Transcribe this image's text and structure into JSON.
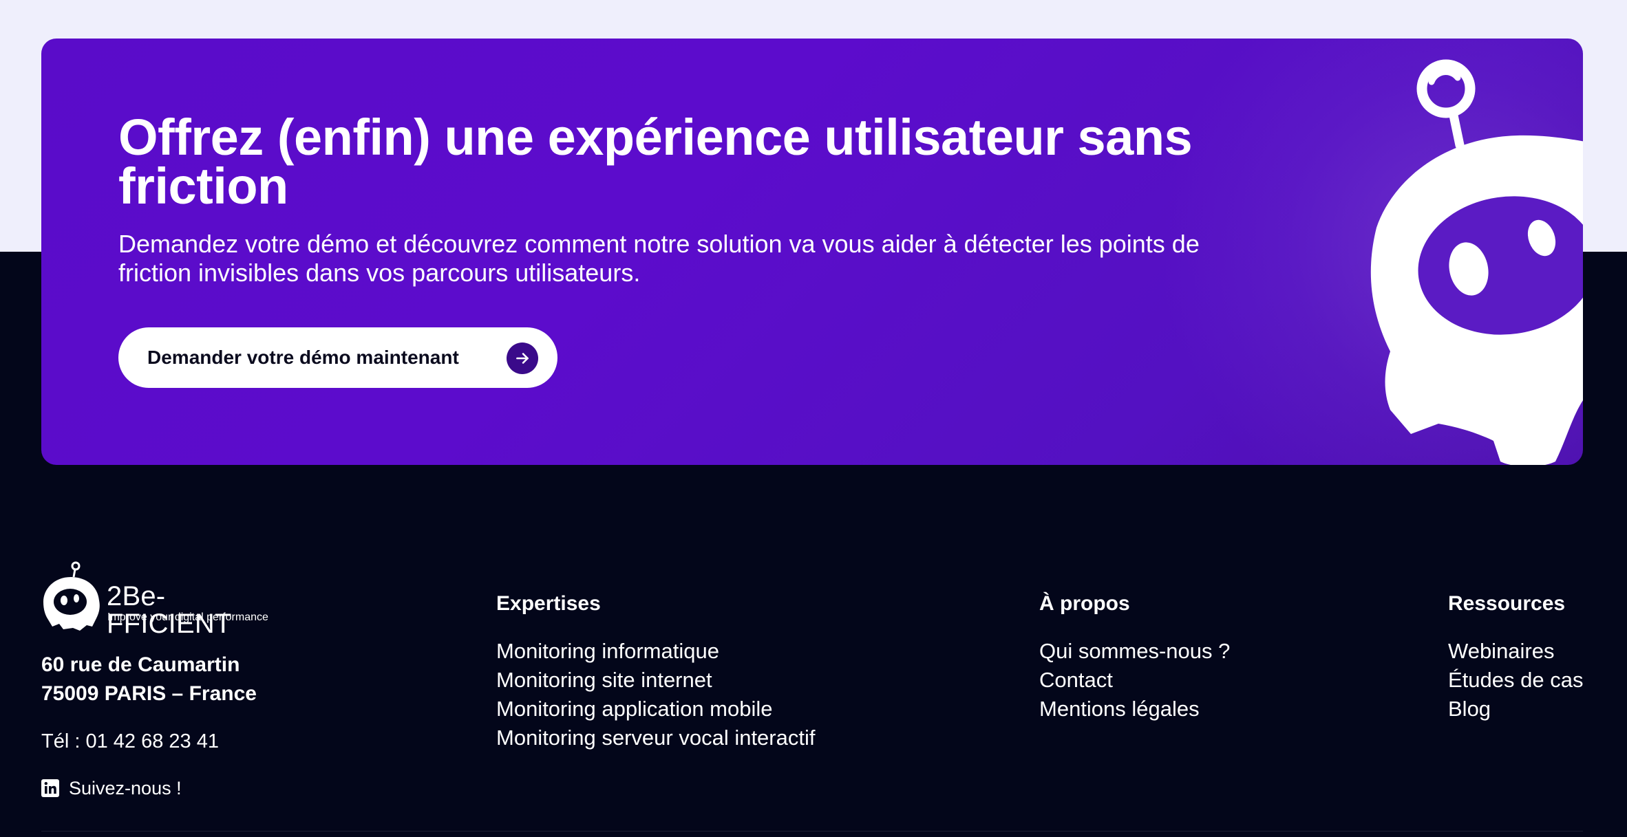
{
  "cta": {
    "title": "Offrez (enfin) une expérience utilisateur sans friction",
    "subtitle": "Demandez votre démo et découvrez comment notre solution va vous aider à détecter les points de friction invisibles dans vos parcours utilisateurs.",
    "button_label": "Demander votre démo maintenant",
    "button_icon": "arrow-right-icon"
  },
  "footer": {
    "logo": {
      "name": "2Be-FFICIENT",
      "tagline": "Improve your digital performance"
    },
    "address": {
      "line1": "60 rue de Caumartin",
      "line2": "75009 PARIS – France"
    },
    "phone": "Tél : 01 42 68 23 41",
    "social": {
      "icon": "linkedin-icon",
      "label": "Suivez-nous !"
    },
    "columns": [
      {
        "heading": "Expertises",
        "links": [
          "Monitoring informatique",
          "Monitoring site internet",
          "Monitoring application mobile",
          "Monitoring serveur vocal interactif"
        ]
      },
      {
        "heading": "À propos",
        "links": [
          "Qui sommes-nous ?",
          "Contact",
          "Mentions légales"
        ]
      },
      {
        "heading": "Ressources",
        "links": [
          "Webinaires",
          "Études de cas",
          "Blog"
        ]
      }
    ]
  },
  "colors": {
    "page_top": "#efeffc",
    "footer_bg": "#03061a",
    "cta_purple": "#5a0cc9",
    "button_bg": "#ffffff",
    "arrow_circle": "#3a0a8a"
  }
}
